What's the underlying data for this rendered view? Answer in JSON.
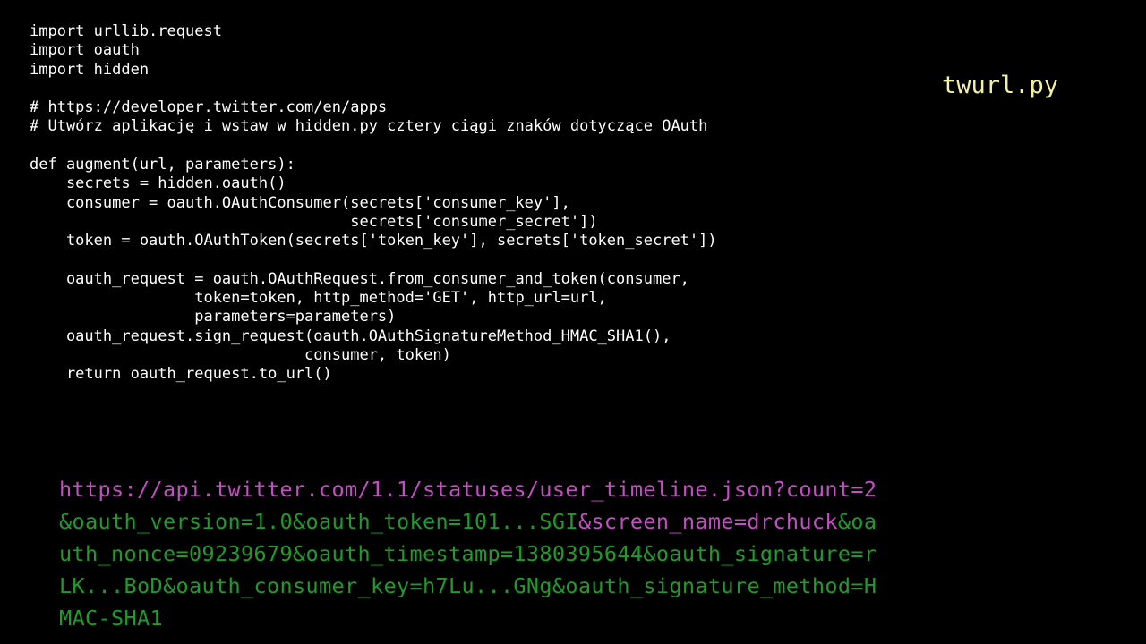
{
  "slide": {
    "background_color": "#000000",
    "title": "twurl.py"
  },
  "colors": {
    "code_text": "#ffffff",
    "title_text": "#f2f2a0",
    "url_magenta": "#c44ec4",
    "url_green": "#1f9b2a"
  },
  "code": {
    "language": "python",
    "lines": [
      "import urllib.request",
      "import oauth",
      "import hidden",
      "",
      "# https://developer.twitter.com/en/apps",
      "# Utwórz aplikację i wstaw w hidden.py cztery ciągi znaków dotyczące OAuth",
      "",
      "def augment(url, parameters):",
      "    secrets = hidden.oauth()",
      "    consumer = oauth.OAuthConsumer(secrets['consumer_key'],",
      "                                   secrets['consumer_secret'])",
      "    token = oauth.OAuthToken(secrets['token_key'], secrets['token_secret'])",
      "",
      "    oauth_request = oauth.OAuthRequest.from_consumer_and_token(consumer,",
      "                  token=token, http_method='GET', http_url=url,",
      "                  parameters=parameters)",
      "    oauth_request.sign_request(oauth.OAuthSignatureMethod_HMAC_SHA1(),",
      "                              consumer, token)",
      "    return oauth_request.to_url()"
    ]
  },
  "url_output": {
    "full_text": "https://api.twitter.com/1.1/statuses/user_timeline.json?count=2&oauth_version=1.0&oauth_token=101...SGI&screen_name=drchuck&oauth_nonce=09239679&oauth_timestamp=1380395644&oauth_signature=rLK...BoD&oauth_consumer_key=h7Lu...GNg&oauth_signature_method=HMAC-SHA1",
    "lines": [
      [
        {
          "text": "https://api.twitter.com/1.1/statuses/user_timeline.json?count=2",
          "color": "magenta"
        }
      ],
      [
        {
          "text": "&oauth_version=1.0&oauth_token=101...SGI",
          "color": "green"
        },
        {
          "text": "&screen_name=drchuck",
          "color": "magenta"
        },
        {
          "text": "&oa",
          "color": "green"
        }
      ],
      [
        {
          "text": "uth_nonce=09239679&oauth_timestamp=1380395644&oauth_signature=r",
          "color": "green"
        }
      ],
      [
        {
          "text": "LK...BoD&oauth_consumer_key=h7Lu...GNg&oauth_signature_method=H",
          "color": "green"
        }
      ],
      [
        {
          "text": "MAC-SHA1",
          "color": "green"
        }
      ]
    ]
  }
}
